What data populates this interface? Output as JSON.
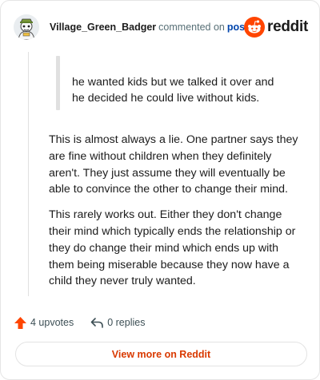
{
  "header": {
    "username": "Village_Green_Badger",
    "action": "commented on",
    "post_link": "post",
    "brand": "reddit"
  },
  "comment": {
    "quote_lines": [
      "he wanted kids but we talked it over and",
      "he decided he could live without kids."
    ],
    "paragraphs": [
      "This is almost always a lie. One partner says they are fine without children when they definitely aren't. They just assume they will eventually be able to convince the other to change their mind.",
      "This rarely works out. Either they don't change their mind which typically ends the relationship or they do change their mind which ends up with them being miserable because they now have a child they never truly wanted."
    ]
  },
  "footer": {
    "upvotes": "4 upvotes",
    "replies": "0 replies",
    "view_more": "View more on Reddit"
  },
  "colors": {
    "accent": "#d93900",
    "reddit_orange": "#ff4500",
    "link": "#0045ac"
  },
  "icons": {
    "avatar": "snoo-avatar",
    "logo": "reddit-snoo-icon",
    "upvote": "upvote-arrow-icon",
    "reply": "reply-arrow-icon"
  }
}
